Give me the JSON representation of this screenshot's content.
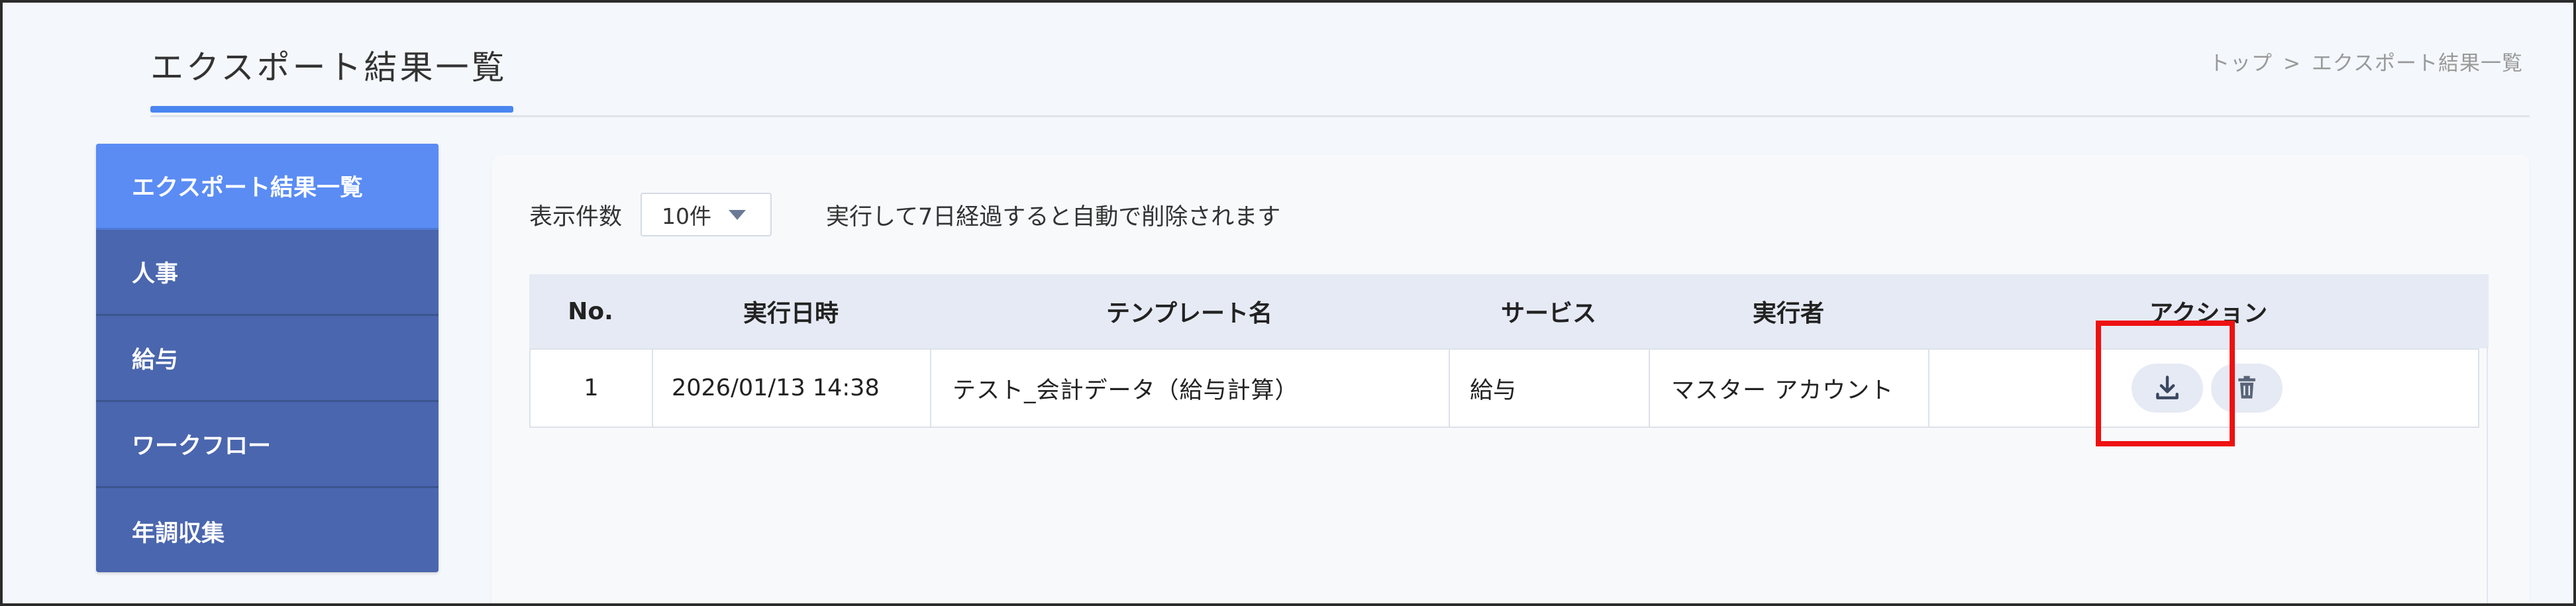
{
  "header": {
    "title": "エクスポート結果一覧",
    "breadcrumb": {
      "home": "トップ",
      "separator": ">",
      "current": "エクスポート結果一覧"
    }
  },
  "sidebar": {
    "items": [
      {
        "label": "エクスポート結果一覧",
        "active": true
      },
      {
        "label": "人事",
        "active": false
      },
      {
        "label": "給与",
        "active": false
      },
      {
        "label": "ワークフロー",
        "active": false
      },
      {
        "label": "年調収集",
        "active": false
      }
    ]
  },
  "toolbar": {
    "per_page_label": "表示件数",
    "per_page_value": "10件",
    "notice": "実行して7日経過すると自動で削除されます"
  },
  "table": {
    "headers": {
      "no": "No.",
      "executed_at": "実行日時",
      "template": "テンプレート名",
      "service": "サービス",
      "executor": "実行者",
      "action": "アクション"
    },
    "rows": [
      {
        "no": "1",
        "executed_at": "2026/01/13 14:38",
        "template": "テスト_会計データ（給与計算）",
        "service": "給与",
        "executor": "マスター アカウント"
      }
    ]
  },
  "colors": {
    "sidebar": "#4a66ae",
    "sidebar_active": "#5a8cf4",
    "accent": "#4a86f0",
    "highlight": "#ee1111"
  },
  "icons": {
    "download": "download-icon",
    "delete": "trash-icon",
    "dropdown": "chevron-down-icon"
  }
}
